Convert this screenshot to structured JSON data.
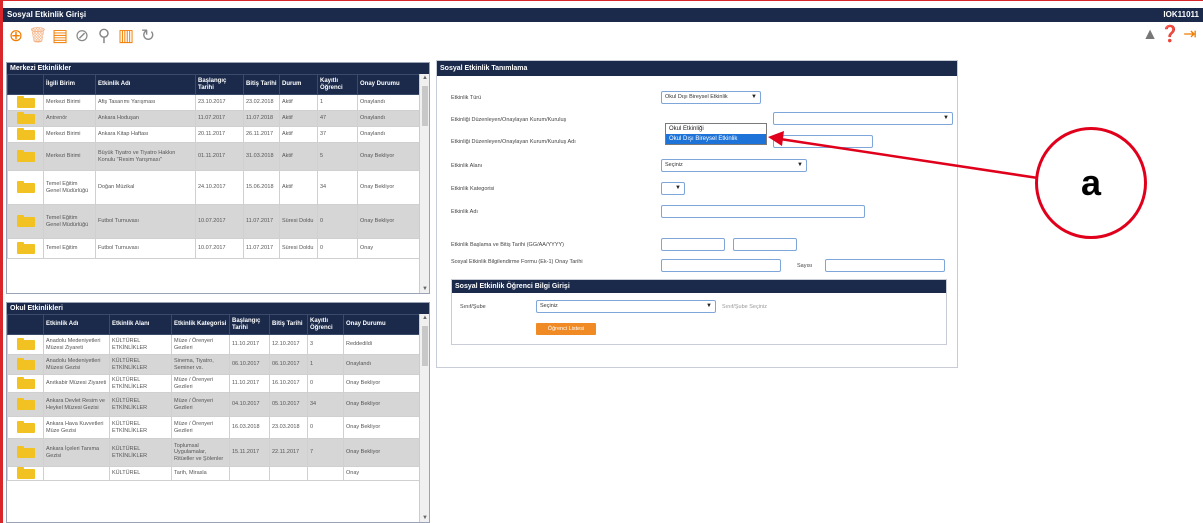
{
  "window": {
    "title": "Sosyal Etkinlik Girişi",
    "code": "IOK11011"
  },
  "toolbar": {
    "left_icons": [
      "add-icon",
      "delete-icon",
      "calendar-icon",
      "cancel-icon",
      "search-icon",
      "print-icon",
      "refresh-icon"
    ],
    "right_icons": [
      "warning-icon",
      "help-icon",
      "exit-icon"
    ]
  },
  "colors": {
    "header": "#1b2a4a",
    "accent": "#f07c00",
    "callout": "#e0001b"
  },
  "merkezi": {
    "title": "Merkezi Etkinlikler",
    "columns": [
      "",
      "İlgili Birim",
      "Etkinlik Adı",
      "Başlangıç Tarihi",
      "Bitiş Tarihi",
      "Durum",
      "Kayıtlı Öğrenci",
      "Onay Durumu"
    ],
    "rows": [
      [
        "Merkezi Birimi",
        "Afiş Tasarımı Yarışması",
        "23.10.2017",
        "23.02.2018",
        "Aktif",
        "1",
        "Onaylandı"
      ],
      [
        "Antrenör",
        "Ankara Hoduşan",
        "11.07.2017",
        "11.07.2018",
        "Aktif",
        "47",
        "Onaylandı"
      ],
      [
        "Merkezi Birimi",
        "Ankara Kitap Haftası",
        "20.11.2017",
        "26.11.2017",
        "Aktif",
        "37",
        "Onaylandı"
      ],
      [
        "Merkezi Birimi",
        "Büyük Tiyatro ve Tiyatro Hakkın Konulu \"Resim Yarışması\"",
        "01.11.2017",
        "31.03.2018",
        "Aktif",
        "5",
        "Onay Bekliyor"
      ],
      [
        "Temel Eğitim Genel Müdürlüğü",
        "Doğan Müzikal",
        "24.10.2017",
        "15.06.2018",
        "Aktif",
        "34",
        "Onay Bekliyor"
      ],
      [
        "Temel Eğitim Genel Müdürlüğü",
        "Futbol Turnuvası",
        "10.07.2017",
        "11.07.2017",
        "Süresi Doldu",
        "0",
        "Onay Bekliyor"
      ],
      [
        "Temel Eğitim",
        "Futbol Turnuvası",
        "10.07.2017",
        "11.07.2017",
        "Süresi Doldu",
        "0",
        "Onay"
      ]
    ]
  },
  "okul": {
    "title": "Okul Etkinlikleri",
    "columns": [
      "",
      "Etkinlik Adı",
      "Etkinlik Alanı",
      "Etkinlik Kategorisi",
      "Başlangıç Tarihi",
      "Bitiş Tarihi",
      "Kayıtlı Öğrenci",
      "Onay Durumu"
    ],
    "rows": [
      [
        "Anadolu Medeniyetleri Müzesi Ziyareti",
        "KÜLTÜREL ETKİNLİKLER",
        "Müze / Örenyeri Gezileri",
        "11.10.2017",
        "12.10.2017",
        "3",
        "Reddedildi"
      ],
      [
        "Anadolu Medeniyetleri Müzesi Gezisi",
        "KÜLTÜREL ETKİNLİKLER",
        "Sinema, Tiyatro, Seminer vs.",
        "06.10.2017",
        "06.10.2017",
        "1",
        "Onaylandı"
      ],
      [
        "Anıtkabir Müzesi Ziyareti",
        "KÜLTÜREL ETKİNLİKLER",
        "Müze / Örenyeri Gezileri",
        "11.10.2017",
        "16.10.2017",
        "0",
        "Onay Bekliyor"
      ],
      [
        "Ankara Devlet Resim ve Heykel Müzesi Gezisi",
        "KÜLTÜREL ETKİNLİKLER",
        "Müze / Örenyeri Gezileri",
        "04.10.2017",
        "05.10.2017",
        "34",
        "Onay Bekliyor"
      ],
      [
        "Ankara Hava Kuvvetleri Müze Gezisi",
        "KÜLTÜREL ETKİNLİKLER",
        "Müze / Örenyeri Gezileri",
        "16.03.2018",
        "23.03.2018",
        "0",
        "Onay Bekliyor"
      ],
      [
        "Ankara İçeleri Tanıma Gezisi",
        "KÜLTÜREL ETKİNLİKLER",
        "Toplumsal Uygulamalar, Ritüeller ve Şölenler",
        "15.11.2017",
        "22.11.2017",
        "7",
        "Onay Bekliyor"
      ],
      [
        "",
        "KÜLTÜREL",
        "Tarih, Mirasla",
        "",
        "",
        "",
        "Onay"
      ]
    ]
  },
  "search": {
    "title": "Sosyal Etkinlik Tanımlama",
    "labels": {
      "type": "Etkinlik Türü",
      "organizer": "Etkinliği Düzenleyen/Onaylayan Kurum/Kuruluş",
      "organizer_name": "Etkinliği Düzenleyen/Onaylayan Kurum/Kuruluş Adı",
      "area": "Etkinlik Alanı",
      "category": "Etkinlik Kategorisi",
      "name": "Etkinlik Adı",
      "dates": "Etkinlik Başlama ve Bitiş Tarihi (GG/AA/YYYY)",
      "form": "Sosyal Etkinlik Bilgilendirme Formu (Ek-1) Onay Tarihi",
      "count": "Sayısı"
    },
    "type_value": "Okul Dışı Bireysel Etkinlik",
    "type_options": [
      "Okul Etkinliği",
      "Okul Dışı Bireysel Etkinlik"
    ],
    "area_value": "Seçiniz"
  },
  "student": {
    "title": "Sosyal Etkinlik Öğrenci Bilgi Girişi",
    "class_label": "Sınıf/Şube",
    "class_value": "Seçiniz",
    "hint": "Sınıf/Şube Seçiniz",
    "button": "Öğrenci Listesi"
  },
  "callout": {
    "label": "a"
  }
}
